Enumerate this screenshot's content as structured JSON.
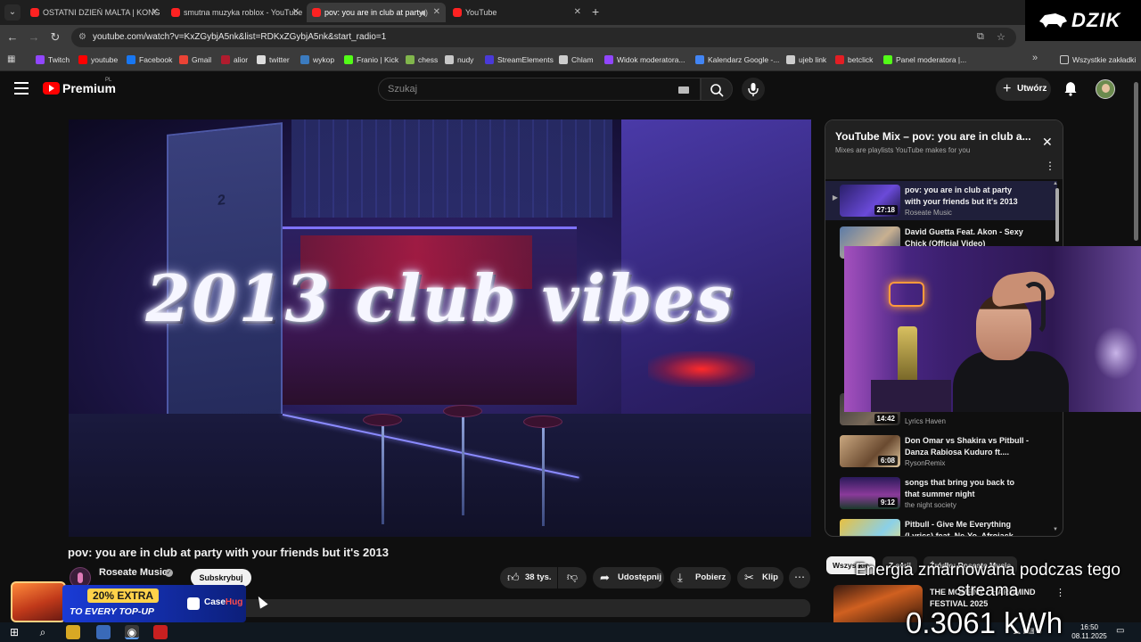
{
  "browser": {
    "tabs": [
      {
        "label": "OSTATNI DZIEŃ MALTA | KONG",
        "active": false
      },
      {
        "label": "smutna muzyka roblox - YouTube",
        "active": false
      },
      {
        "label": "pov: you are in club at party",
        "active": true
      },
      {
        "label": "YouTube",
        "active": false
      }
    ],
    "url": "youtube.com/watch?v=KxZGybjA5nk&list=RDKxZGybjA5nk&start_radio=1",
    "bookmarks": [
      {
        "label": "Twitch",
        "color": "#9146ff"
      },
      {
        "label": "youtube",
        "color": "#ff0000"
      },
      {
        "label": "Facebook",
        "color": "#1877f2"
      },
      {
        "label": "Gmail",
        "color": "#ea4335"
      },
      {
        "label": "alior",
        "color": "#b01c2e"
      },
      {
        "label": "twitter",
        "color": "#dddddd"
      },
      {
        "label": "wykop",
        "color": "#3b7bbf"
      },
      {
        "label": "Franio | Kick",
        "color": "#53fc18"
      },
      {
        "label": "chess",
        "color": "#81b64c"
      },
      {
        "label": "nudy",
        "color": "#c8c8c8"
      },
      {
        "label": "StreamElements",
        "color": "#4a3ad8"
      },
      {
        "label": "Chlam",
        "color": "#cccccc"
      },
      {
        "label": "Widok moderatora...",
        "color": "#9146ff"
      },
      {
        "label": "Kalendarz Google -...",
        "color": "#4285f4"
      },
      {
        "label": "ujeb link",
        "color": "#cccccc"
      },
      {
        "label": "betclick",
        "color": "#e31e24"
      },
      {
        "label": "Panel moderatora |...",
        "color": "#53fc18"
      }
    ],
    "all_bookmarks": "Wszystkie zakładki"
  },
  "overlay_brand": "DZIK",
  "header": {
    "logo_text": "Premium",
    "logo_country": "PL",
    "search_placeholder": "Szukaj",
    "create_label": "Utwórz"
  },
  "video": {
    "overlay_text": "2013 club vibes",
    "title": "pov: you are in club at party with your friends but it's 2013",
    "channel": "Roseate Music",
    "subscribe_label": "Subskrybuj",
    "likes": "38 tys.",
    "share_label": "Udostępnij",
    "download_label": "Pobierz",
    "clip_label": "Klip"
  },
  "playlist": {
    "title": "YouTube Mix – pov: you are in club a...",
    "subtitle": "Mixes are playlists YouTube makes for you",
    "items": [
      {
        "index": "▶",
        "title": "pov: you are in club at party with your friends but it's 2013",
        "channel": "Roseate Music",
        "duration": "27:18",
        "current": true,
        "thumb": "linear-gradient(135deg,#2a1f6a,#6a4ad8 60%,#1a1440)"
      },
      {
        "index": "",
        "title": "David Guetta Feat. Akon - Sexy Chick (Official Video)",
        "channel": "",
        "duration": "",
        "current": false,
        "thumb": "linear-gradient(135deg,#5a7aa8,#c8b090 60%,#3a4a68)"
      },
      {
        "index": "",
        "title": "",
        "channel": "Lyrics Haven",
        "duration": "14:42",
        "current": false,
        "thumb": "linear-gradient(135deg,#3a3a3a,#7a6a5a 60%,#222)"
      },
      {
        "index": "",
        "title": "Don Omar vs Shakira vs Pitbull - Danza Rabiosa Kuduro ft....",
        "channel": "RysonRemix",
        "duration": "6:08",
        "current": false,
        "thumb": "linear-gradient(135deg,#caa880,#6a4a30 60%,#e0c8a0)"
      },
      {
        "index": "",
        "title": "songs that bring you back to that summer night",
        "channel": "the night society",
        "duration": "9:12",
        "current": false,
        "thumb": "linear-gradient(180deg,#2a1a5a,#8a3a9a 55%,#1a3a2a)"
      },
      {
        "index": "",
        "title": "Pitbull - Give Me Everything (Lyrics) feat. Ne-Yo, Afrojack ...",
        "channel": "",
        "duration": "",
        "current": false,
        "thumb": "linear-gradient(135deg,#e8c040,#8ad0e8 60%,#f0e080)"
      }
    ]
  },
  "chips": [
    "Wszystkie",
    "Z serii",
    "Źródło: Roseate Music"
  ],
  "recommendation": {
    "title": "THE MOMENT... HARDMIND FESTIVAL 2025"
  },
  "stream_overlay": {
    "energy_label": "Energia zmarnowana podczas tego streama",
    "energy_value": "0.3061 kWh"
  },
  "ad": {
    "line1": "20% EXTRA",
    "line2": "TO EVERY TOP-UP",
    "brand_a": "Case",
    "brand_b": "Hug"
  },
  "taskbar": {
    "time": "16:50",
    "date": "08.11.2025"
  }
}
